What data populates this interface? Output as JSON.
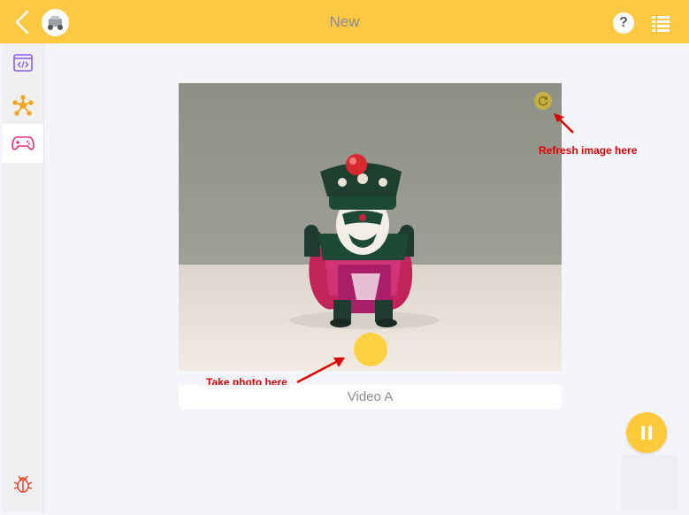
{
  "header": {
    "title": "New",
    "back_icon": "chevron-left-icon",
    "help_label": "?",
    "menu_icon": "list-icon"
  },
  "sidebar": {
    "items": [
      {
        "icon": "code-window-icon",
        "active": false
      },
      {
        "icon": "network-node-icon",
        "active": false
      },
      {
        "icon": "gamepad-icon",
        "active": true
      }
    ],
    "bottom_icon": "bug-icon"
  },
  "camera": {
    "refresh_annotation": "Refresh image here",
    "shutter_annotation": "Take photo here",
    "video_label": "Video A"
  },
  "controls": {
    "pause_icon": "pause-icon"
  },
  "colors": {
    "accent": "#ffc843",
    "annotation": "#e00000",
    "sidebar_purple": "#8a5cf0",
    "sidebar_orange": "#f5a51e",
    "sidebar_pink": "#ea2f7a",
    "bug_red": "#e8462a"
  }
}
